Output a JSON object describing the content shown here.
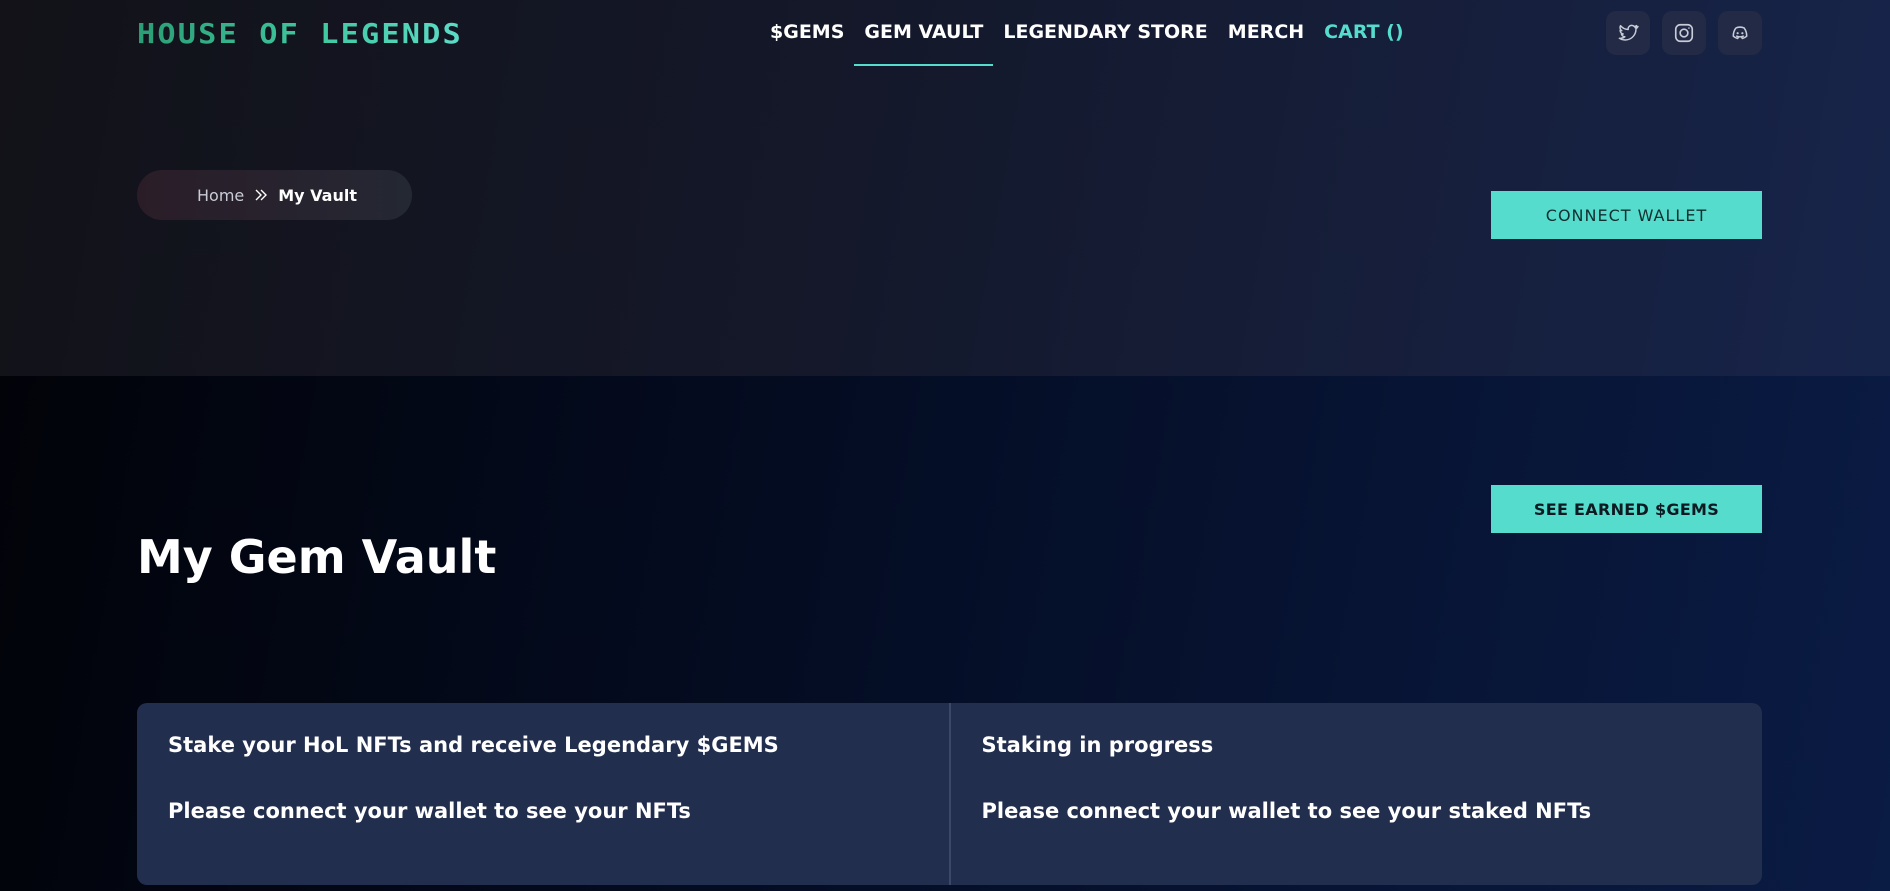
{
  "brand": {
    "logo_text": "HOUSE OF LEGENDS",
    "accent_color": "#55dccc",
    "logo_gradient": [
      "#2a9d74",
      "#5ddcc8"
    ]
  },
  "nav": {
    "items": [
      {
        "label": "$GEMS",
        "active": false
      },
      {
        "label": "GEM VAULT",
        "active": true
      },
      {
        "label": "LEGENDARY STORE",
        "active": false
      },
      {
        "label": "MERCH",
        "active": false
      },
      {
        "label": "CART ()",
        "active": false
      }
    ]
  },
  "socials": [
    {
      "icon": "twitter-icon"
    },
    {
      "icon": "instagram-icon"
    },
    {
      "icon": "discord-icon"
    }
  ],
  "breadcrumb": {
    "home": "Home",
    "current": "My Vault"
  },
  "hero": {
    "connect_wallet_label": "CONNECT WALLET"
  },
  "main": {
    "title": "My Gem Vault",
    "see_earned_label": "SEE EARNED $GEMS",
    "stake_panel": {
      "heading": "Stake your HoL NFTs and receive Legendary $GEMS",
      "message": "Please connect your wallet to see your NFTs"
    },
    "staking_panel": {
      "heading": "Staking in progress",
      "message": "Please connect your wallet to see your staked NFTs"
    }
  }
}
